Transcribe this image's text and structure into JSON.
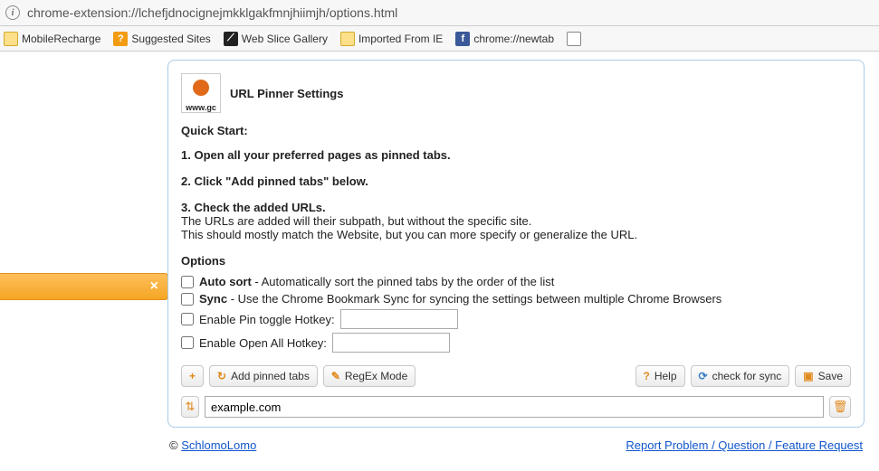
{
  "addressBar": {
    "url": "chrome-extension://lchefjdnocignejmkklgakfmnjhiimjh/options.html"
  },
  "bookmarks": [
    {
      "label": "MobileRecharge"
    },
    {
      "label": "Suggested Sites"
    },
    {
      "label": "Web Slice Gallery"
    },
    {
      "label": "Imported From IE"
    },
    {
      "label": "chrome://newtab"
    },
    {
      "label": ""
    }
  ],
  "header": {
    "title": "URL Pinner Settings",
    "logoText": "www.gc"
  },
  "quickStart": {
    "heading": "Quick Start:",
    "step1": "1. Open all your preferred pages as pinned tabs.",
    "step2": "2. Click \"Add pinned tabs\" below.",
    "step3": "3. Check the added URLs.",
    "step3a": "The URLs are added will their subpath, but without the specific site.",
    "step3b": "This should mostly match the Website, but you can more specify or generalize the URL."
  },
  "options": {
    "heading": "Options",
    "autoSortLabel": "Auto sort",
    "autoSortDesc": " - Automatically sort the pinned tabs by the order of the list",
    "syncLabel": "Sync",
    "syncDesc": " - Use the Chrome Bookmark Sync for syncing the settings between multiple Chrome Browsers",
    "pinHotkeyLabel": "Enable Pin toggle Hotkey:",
    "pinHotkeyValue": "",
    "openAllLabel": "Enable Open All Hotkey:",
    "openAllValue": ""
  },
  "toolbar": {
    "addSymbol": "+",
    "addPinned": "Add pinned tabs",
    "regex": "RegEx Mode",
    "help": "Help",
    "checkSync": "check for sync",
    "save": "Save"
  },
  "urlRow": {
    "value": "example.com"
  },
  "footer": {
    "copyright": "© ",
    "author": "SchlomoLomo",
    "reportLink": "Report Problem / Question / Feature Request"
  }
}
